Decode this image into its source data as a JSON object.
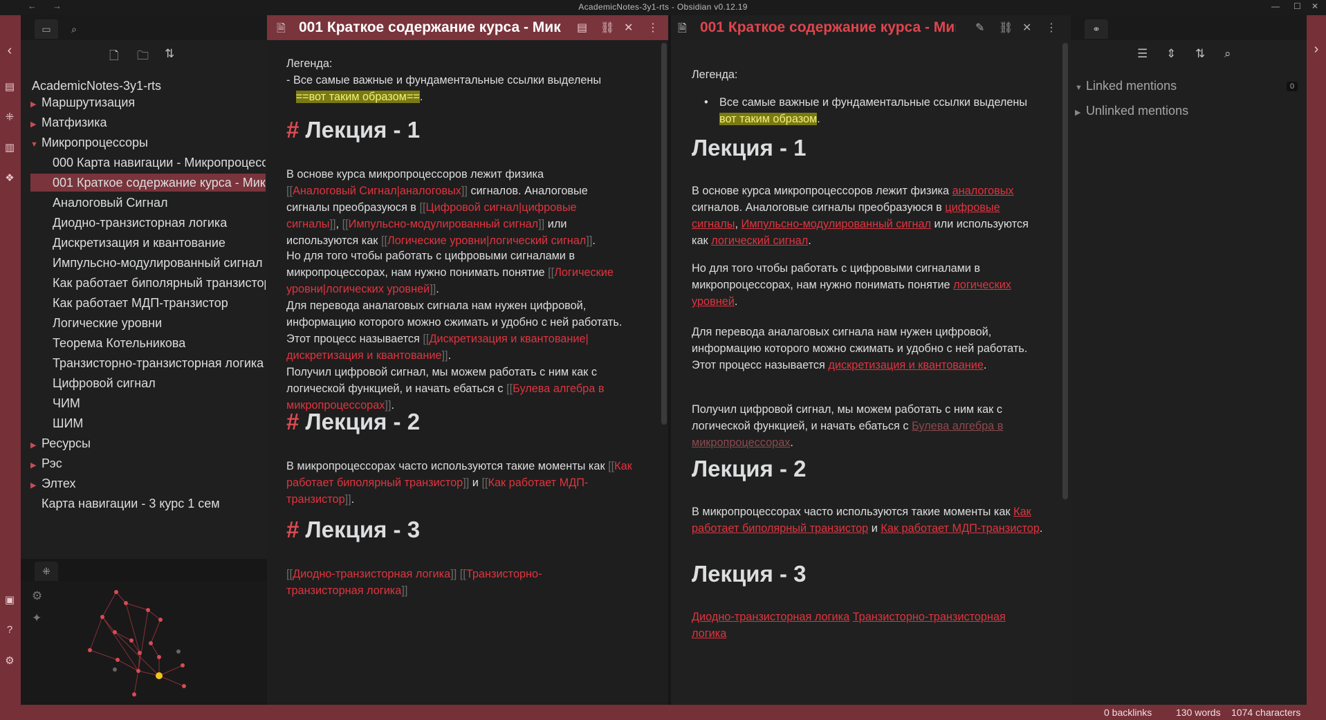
{
  "titlebar": {
    "title": "AcademicNotes-3y1-rts - Obsidian v0.12.19",
    "back": "←",
    "forward": "→",
    "minimize": "—",
    "maximize": "☐",
    "close": "✕"
  },
  "colors": {
    "accent": "#763038",
    "link": "#e0343f",
    "highlight_bg": "#7a7a14",
    "highlight_fg": "#f0f078"
  },
  "sidebar": {
    "tab_icons": [
      "folder-icon",
      "search-icon"
    ],
    "actions": [
      "new-note-icon",
      "new-folder-icon",
      "sort-icon"
    ],
    "vault_name": "AcademicNotes-3y1-rts",
    "items": [
      {
        "label": "Маршрутизация",
        "type": "folder",
        "state": "collapsed"
      },
      {
        "label": "Матфизика",
        "type": "folder",
        "state": "collapsed"
      },
      {
        "label": "Микропроцессоры",
        "type": "folder",
        "state": "expanded"
      },
      {
        "label": "000 Карта навигации - Микропроцессоры",
        "type": "file"
      },
      {
        "label": "001 Краткое содержание курса - Микропроцессоры",
        "type": "file",
        "active": true
      },
      {
        "label": "Аналоговый Сигнал",
        "type": "file"
      },
      {
        "label": "Диодно-транзисторная логика",
        "type": "file"
      },
      {
        "label": "Дискретизация и квантование",
        "type": "file"
      },
      {
        "label": "Импульсно-модулированный сигнал",
        "type": "file"
      },
      {
        "label": "Как работает биполярный транзистор",
        "type": "file"
      },
      {
        "label": "Как работает МДП-транзистор",
        "type": "file"
      },
      {
        "label": "Логические уровни",
        "type": "file"
      },
      {
        "label": "Теорема Котельникова",
        "type": "file"
      },
      {
        "label": "Транзисторно-транзисторная логика",
        "type": "file"
      },
      {
        "label": "Цифровой сигнал",
        "type": "file"
      },
      {
        "label": "ЧИМ",
        "type": "file"
      },
      {
        "label": "ШИМ",
        "type": "file"
      },
      {
        "label": "Ресурсы",
        "type": "folder",
        "state": "collapsed"
      },
      {
        "label": "Рэс",
        "type": "folder",
        "state": "collapsed"
      },
      {
        "label": "Элтех",
        "type": "folder",
        "state": "collapsed"
      },
      {
        "label": "Карта навигации - 3 курс 1 сем",
        "type": "file-root"
      }
    ],
    "graph_tab_icon": "graph-icon",
    "graph_controls": [
      "settings-icon",
      "magic-wand-icon"
    ]
  },
  "left_ribbon": [
    "chevron-left-icon",
    "open-quick-switcher-icon",
    "graph-view-icon",
    "open-daily-note-icon",
    "plugins-icon",
    "vault-icon",
    "help-icon",
    "settings-icon"
  ],
  "right_ribbon": [
    "chevron-right-icon"
  ],
  "source_pane": {
    "title": "001 Краткое содержание курса - Мик",
    "header_icons": [
      "reading-view-icon",
      "link-icon",
      "close-icon",
      "more-options-icon"
    ],
    "legend": "Легенда:",
    "bullet_prefix": "- ",
    "bullet_text": "Все самые важные и фундаментальные ссылки выделены",
    "bullet_highlight": "==вот таким образом==",
    "dot": ".",
    "h1_hash": "#",
    "h1_lecture1": "Лекция - 1",
    "p1": {
      "t1": "В основе курса микропроцессоров лежит физика",
      "l1": "Аналоговый Сигнал|аналоговых",
      "t2": " сигналов. Аналоговые сигналы преобразуюся в ",
      "l2": "Цифровой сигнал|цифровые сигналы",
      "t3": ", ",
      "l3": "Импульсно-модулированный сигнал",
      "t4": " или используются как ",
      "l4": "Логические уровни|логический сигнал",
      "t5": "."
    },
    "p2": {
      "t1": "Но для того чтобы работать с цифровыми сигналами в микропроцессорах, нам нужно понимать понятие ",
      "l1": "Логические уровни|логических уровней",
      "t2": "."
    },
    "p3": {
      "t1": "Для перевода аналаговых сигнала нам нужен цифровой, информацию которого можно сжимать и удобно с ней работать. Этот процесс называется ",
      "l1": "Дискретизация и квантование|дискретизация и квантование",
      "t2": "."
    },
    "p4": {
      "t1": "Получил цифровой сигнал, мы можем работать с ним как с логической функцией, и начать ебаться с ",
      "l1": "Булева алгебра в микропроцессорах",
      "t2": "."
    },
    "h1_lecture2": "Лекция - 2",
    "p5": {
      "t1": "В микропроцессорах часто используются такие моменты как ",
      "l1": "Как работает биполярный транзистор",
      "t2": " и ",
      "l2": "Как работает МДП-транзистор",
      "t3": "."
    },
    "h1_lecture3": "Лекция - 3",
    "p6": {
      "l1": "Диодно-транзисторная логика",
      "l2": "Транзисторно-транзисторная логика"
    },
    "brackets_open": "[[",
    "brackets_close": "]]"
  },
  "preview_pane": {
    "title": "001 Краткое содержание курса - Мик",
    "header_icons": [
      "edit-icon",
      "link-icon",
      "close-icon",
      "more-options-icon"
    ],
    "legend": "Легенда:",
    "bullet_text": "Все самые важные и фундаментальные ссылки выделены ",
    "bullet_highlight": "вот таким образом",
    "dot": ".",
    "h1_lecture1": "Лекция - 1",
    "p1": {
      "t1": "В основе курса микропроцессоров лежит физика ",
      "l1": "аналоговых",
      "t2": " сигналов. Аналоговые сигналы преобразуюся в ",
      "l2": "цифровые сигналы",
      "t3": ", ",
      "l3": "Импульсно-модулированный сигнал",
      "t4": " или используются как ",
      "l4": "логический сигнал",
      "t5": "."
    },
    "p2": {
      "t1": "Но для того чтобы работать с цифровыми сигналами в микропроцессорах, нам нужно понимать понятие ",
      "l1": "логических уровней",
      "t2": "."
    },
    "p3": {
      "t1": "Для перевода аналаговых сигнала нам нужен цифровой, информацию которого можно сжимать и удобно с ней работать. Этот процесс называется ",
      "l1": "дискретизация и квантование",
      "t2": "."
    },
    "p4": {
      "t1": "Получил цифровой сигнал, мы можем работать с ним как с логической функцией, и начать ебаться с ",
      "l1": "Булева алгебра в микропроцессорах",
      "t2": "."
    },
    "h1_lecture2": "Лекция - 2",
    "p5": {
      "t1": "В микропроцессорах часто используются такие моменты как ",
      "l1": "Как работает биполярный транзистор",
      "t2": " и ",
      "l2": "Как работает МДП-транзистор",
      "t3": "."
    },
    "h1_lecture3": "Лекция - 3",
    "p6": {
      "l1": "Диодно-транзисторная логика",
      "sep": " ",
      "l2": "Транзисторно-транзисторная логика"
    }
  },
  "backlinks": {
    "tab_icon": "backlinks-icon",
    "toolbar_icons": [
      "collapse-results-icon",
      "show-more-context-icon",
      "sort-icon",
      "search-icon"
    ],
    "linked": "Linked mentions",
    "linked_count": "0",
    "unlinked": "Unlinked mentions"
  },
  "status": {
    "backlinks": "0 backlinks",
    "words": "130 words",
    "characters": "1074 characters"
  }
}
